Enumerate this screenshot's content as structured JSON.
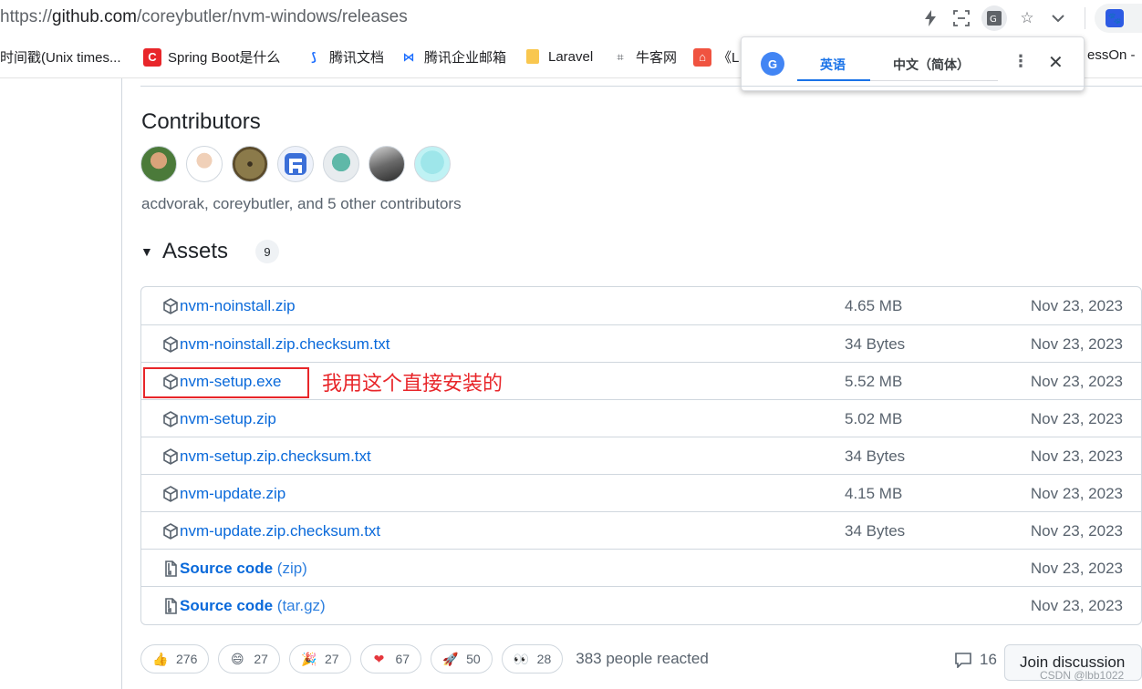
{
  "browser": {
    "url_prefix": "https://",
    "url_host": "github.com",
    "url_path": "/coreybutler/nvm-windows/releases"
  },
  "bookmarks": [
    {
      "label": "时间戳(Unix times...",
      "icon": "timestamp-icon"
    },
    {
      "label": "Spring Boot是什么",
      "icon": "c-logo-icon",
      "color": "#e8262a"
    },
    {
      "label": "腾讯文档",
      "icon": "tencent-docs-icon",
      "color": "#1e6fff"
    },
    {
      "label": "腾讯企业邮箱",
      "icon": "tencent-mail-icon",
      "color": "#1e6fff"
    },
    {
      "label": "Laravel",
      "icon": "folder-icon",
      "color": "#f9c74f"
    },
    {
      "label": "牛客网",
      "icon": "nowcoder-icon"
    },
    {
      "label": "《L",
      "icon": "laravel-icon",
      "color": "#f05340"
    },
    {
      "label": "essOn - ",
      "icon": ""
    }
  ],
  "translate_popup": {
    "tab_source": "英语",
    "tab_target": "中文（简体）"
  },
  "contributors": {
    "title": "Contributors",
    "summary": "acdvorak, coreybutler, and 5 other contributors",
    "avatars": [
      "avatar-1",
      "avatar-2",
      "avatar-3",
      "avatar-4",
      "avatar-5",
      "avatar-6",
      "avatar-7"
    ]
  },
  "assets": {
    "title": "Assets",
    "count": "9",
    "rows": [
      {
        "name": "nvm-noinstall.zip",
        "fmt": "",
        "size": "4.65 MB",
        "date": "Nov 23, 2023",
        "icon": "package-icon"
      },
      {
        "name": "nvm-noinstall.zip.checksum.txt",
        "fmt": "",
        "size": "34 Bytes",
        "date": "Nov 23, 2023",
        "icon": "package-icon"
      },
      {
        "name": "nvm-setup.exe",
        "fmt": "",
        "size": "5.52 MB",
        "date": "Nov 23, 2023",
        "icon": "package-icon"
      },
      {
        "name": "nvm-setup.zip",
        "fmt": "",
        "size": "5.02 MB",
        "date": "Nov 23, 2023",
        "icon": "package-icon"
      },
      {
        "name": "nvm-setup.zip.checksum.txt",
        "fmt": "",
        "size": "34 Bytes",
        "date": "Nov 23, 2023",
        "icon": "package-icon"
      },
      {
        "name": "nvm-update.zip",
        "fmt": "",
        "size": "4.15 MB",
        "date": "Nov 23, 2023",
        "icon": "package-icon"
      },
      {
        "name": "nvm-update.zip.checksum.txt",
        "fmt": "",
        "size": "34 Bytes",
        "date": "Nov 23, 2023",
        "icon": "package-icon"
      },
      {
        "name": "Source code",
        "fmt": "(zip)",
        "size": "",
        "date": "Nov 23, 2023",
        "icon": "file-zip-icon"
      },
      {
        "name": "Source code",
        "fmt": "(tar.gz)",
        "size": "",
        "date": "Nov 23, 2023",
        "icon": "file-zip-icon"
      }
    ]
  },
  "annotation": {
    "text": "我用这个直接安装的",
    "color": "#e8262a"
  },
  "reactions": {
    "items": [
      {
        "emoji": "👍",
        "name": "thumbs-up-icon",
        "count": "276"
      },
      {
        "emoji": "😄",
        "name": "laugh-icon",
        "count": "27"
      },
      {
        "emoji": "🎉",
        "name": "hooray-icon",
        "count": "27"
      },
      {
        "emoji": "❤",
        "name": "heart-icon",
        "count": "67"
      },
      {
        "emoji": "🚀",
        "name": "rocket-icon",
        "count": "50"
      },
      {
        "emoji": "👀",
        "name": "eyes-icon",
        "count": "28"
      }
    ],
    "summary": "383 people reacted"
  },
  "discussion": {
    "comment_count": "16",
    "join_label": "Join discussion"
  },
  "watermark": "CSDN @lbb1022"
}
